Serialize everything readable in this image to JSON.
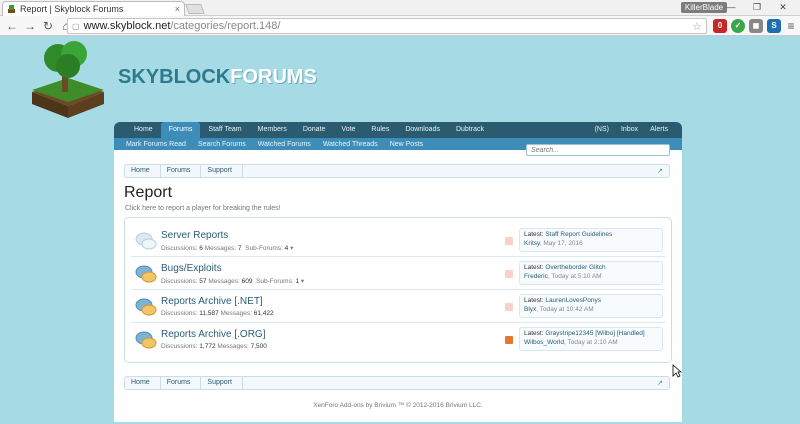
{
  "browser": {
    "tab_title": "Report | Skyblock Forums",
    "tab_close": "×",
    "user_badge": "KillerBlade",
    "win_min": "—",
    "win_max": "❐",
    "win_close": "✕",
    "url_host": "www.skyblock.net",
    "url_path": "/categories/report.148/",
    "nav_back": "←",
    "nav_forward": "→",
    "nav_reload": "↻",
    "nav_home": "⌂",
    "star": "☆",
    "menu": "≡",
    "ext_adblock": "0",
    "ext_green": "✓",
    "ext_gray": "◼",
    "ext_blue": "S"
  },
  "brand": {
    "part1": "SKYBLOCK",
    "part2": "FORUMS"
  },
  "mainnav": {
    "items": [
      "Home",
      "Forums",
      "Staff Team",
      "Members",
      "Donate",
      "Vote",
      "Rules",
      "Downloads",
      "Dubtrack"
    ],
    "right": [
      "(NS)",
      "Inbox",
      "Alerts"
    ]
  },
  "subnav": {
    "items": [
      "Mark Forums Read",
      "Search Forums",
      "Watched Forums",
      "Watched Threads",
      "New Posts"
    ]
  },
  "search": {
    "placeholder": "Search..."
  },
  "breadcrumb": [
    "Home",
    "Forums",
    "Support"
  ],
  "breadcrumb_jump": "↗",
  "page": {
    "title": "Report",
    "description": "Click here to report a player for breaking the rules!"
  },
  "nodes": [
    {
      "title": "Server Reports",
      "discussions_label": "Discussions:",
      "discussions": "6",
      "messages_label": "Messages:",
      "messages": "7",
      "subforums_label": "Sub-Forums:",
      "subforums": "4",
      "latest_label": "Latest:",
      "latest_title": "Staff Report Guidelines",
      "latest_user": "Kritsy",
      "latest_time": ", May 17, 2016"
    },
    {
      "title": "Bugs/Exploits",
      "discussions_label": "Discussions:",
      "discussions": "57",
      "messages_label": "Messages:",
      "messages": "609",
      "subforums_label": "Sub-Forums:",
      "subforums": "1",
      "latest_label": "Latest:",
      "latest_title": "Overtheborder Glitch",
      "latest_user": "Frederic",
      "latest_time": ", Today at 5:10 AM"
    },
    {
      "title": "Reports Archive [.NET]",
      "discussions_label": "Discussions:",
      "discussions": "11,587",
      "messages_label": "Messages:",
      "messages": "61,422",
      "latest_label": "Latest:",
      "latest_title": "LaurenLovesPonys",
      "latest_user": "Blyx",
      "latest_time": ", Today at 10:42 AM"
    },
    {
      "title": "Reports Archive [.ORG]",
      "discussions_label": "Discussions:",
      "discussions": "1,772",
      "messages_label": "Messages:",
      "messages": "7,500",
      "latest_label": "Latest:",
      "latest_title": "Graystripe12345 [Wilbo] [Handled]",
      "latest_user": "Wilbos_World",
      "latest_time": ", Today at 2:10 AM"
    }
  ],
  "subforum_toggle": "▾",
  "footer": "XenForo Add-ons by Brivium ™ © 2012-2016 Brivium LLC.",
  "colors": {
    "nav": "#2b5b70",
    "subnav": "#3e8db8",
    "bg": "#a6dbe6"
  }
}
